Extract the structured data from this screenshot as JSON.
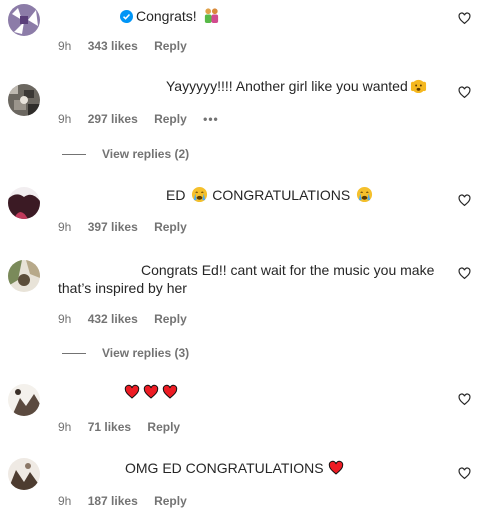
{
  "comments": [
    {
      "username": "",
      "text": "Congrats! ",
      "emoji": "couple-emoji",
      "time": "9h",
      "likes": "343 likes",
      "reply": "Reply",
      "verified": true
    },
    {
      "username": "",
      "text": "Yayyyyy!!!! Another girl like you wanted",
      "emoji": "pouting-face-emoji",
      "time": "9h",
      "likes": "297 likes",
      "reply": "Reply",
      "more": "•••",
      "view_replies": "View replies (2)"
    },
    {
      "username": "",
      "text_prefix": "ED ",
      "text": " CONGRATULATIONS ",
      "emoji": "crying-face-emoji",
      "time": "9h",
      "likes": "397 likes",
      "reply": "Reply"
    },
    {
      "username": "",
      "text_line1": "Congrats Ed!! cant wait for the music you make",
      "text_line2": "that’s inspired by her",
      "time": "9h",
      "likes": "432 likes",
      "reply": "Reply",
      "view_replies": "View replies (3)"
    },
    {
      "username": "",
      "emoji": "three-red-hearts-emoji",
      "time": "9h",
      "likes": "71 likes",
      "reply": "Reply"
    },
    {
      "username": "",
      "text": "OMG ED CONGRATULATIONS ",
      "emoji": "red-heart-emoji",
      "time": "9h",
      "likes": "187 likes",
      "reply": "Reply"
    }
  ],
  "colors": {
    "meta_text": "#737373",
    "verified_blue": "#0095f6",
    "heart_red": "#ed1c24"
  }
}
